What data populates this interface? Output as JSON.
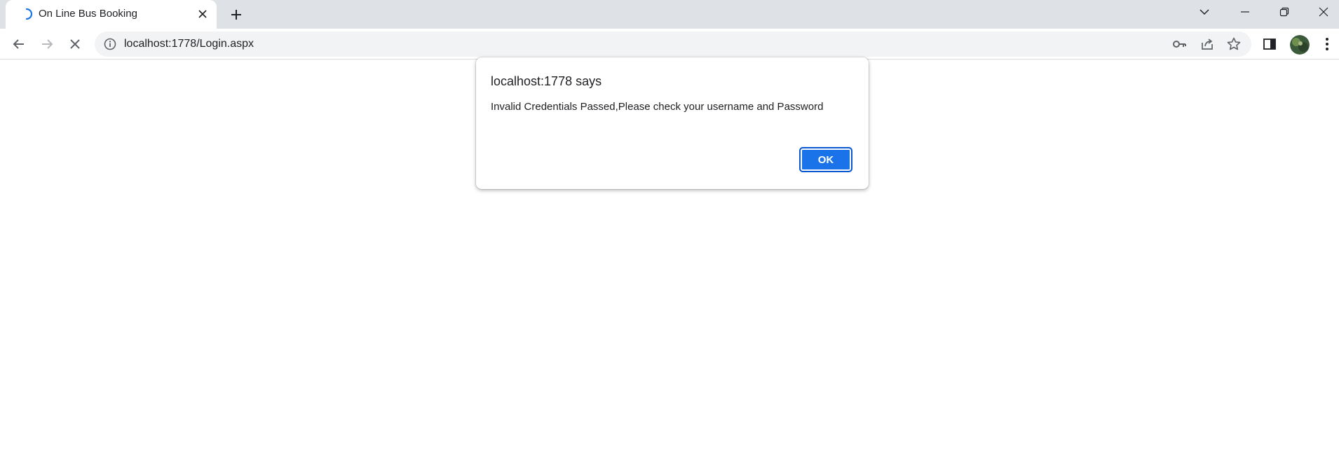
{
  "browser": {
    "tab": {
      "title": "On Line Bus Booking",
      "state": "loading"
    },
    "address_bar": {
      "url": "localhost:1778/Login.aspx"
    },
    "colors": {
      "tabstrip": "#dee1e6",
      "omnibox": "#f1f3f4",
      "accent": "#1a73e8"
    }
  },
  "dialog": {
    "title": "localhost:1778 says",
    "message": "Invalid Credentials Passed,Please check your username and Password",
    "ok_label": "OK"
  }
}
